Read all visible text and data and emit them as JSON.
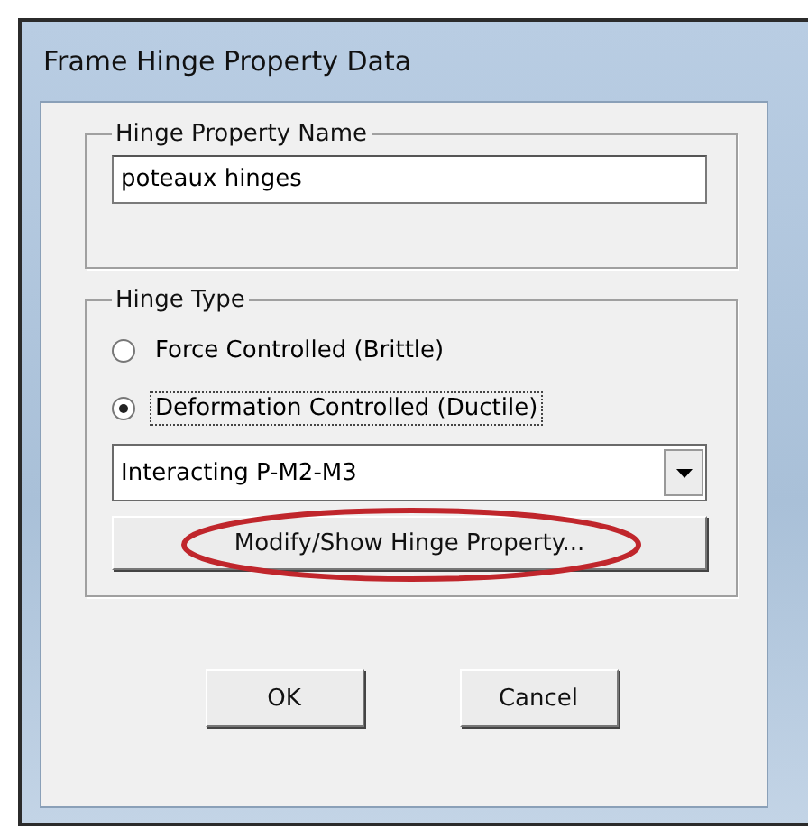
{
  "window": {
    "title": "Frame Hinge Property Data"
  },
  "name_group": {
    "label": "Hinge Property Name",
    "value": "poteaux hinges"
  },
  "type_group": {
    "label": "Hinge Type",
    "options": [
      {
        "label": "Force Controlled  (Brittle)",
        "selected": false
      },
      {
        "label": "Deformation Controlled  (Ductile)",
        "selected": true
      }
    ],
    "dropdown": {
      "value": "Interacting P-M2-M3"
    },
    "modify_button": {
      "label": "Modify/Show Hinge Property...",
      "highlighted": true
    }
  },
  "buttons": [
    "OK",
    "Cancel"
  ]
}
